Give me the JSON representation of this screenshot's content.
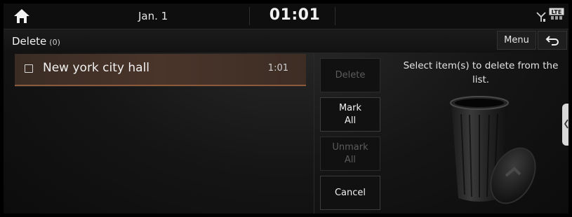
{
  "status": {
    "date": "Jan. 1",
    "time": "01:01",
    "network_badge": "LTE",
    "icons": [
      "home-icon",
      "signal-icon",
      "lte-icon"
    ]
  },
  "header": {
    "title": "Delete",
    "count": "(0)",
    "menu_label": "Menu",
    "back_icon": "back-arrow-icon"
  },
  "list": {
    "items": [
      {
        "label": "New york city hall",
        "time": "1:01",
        "checked": false
      }
    ]
  },
  "actions": {
    "delete_label": "Delete",
    "mark_all_label": "Mark\nAll",
    "unmark_all_label": "Unmark\nAll",
    "cancel_label": "Cancel"
  },
  "instruction": "Select item(s) to delete from the list.",
  "colors": {
    "selected_row": "#4a352a",
    "selected_row_border": "#8a5a3a",
    "background": "#151515",
    "disabled_text": "#5c5c5c"
  }
}
